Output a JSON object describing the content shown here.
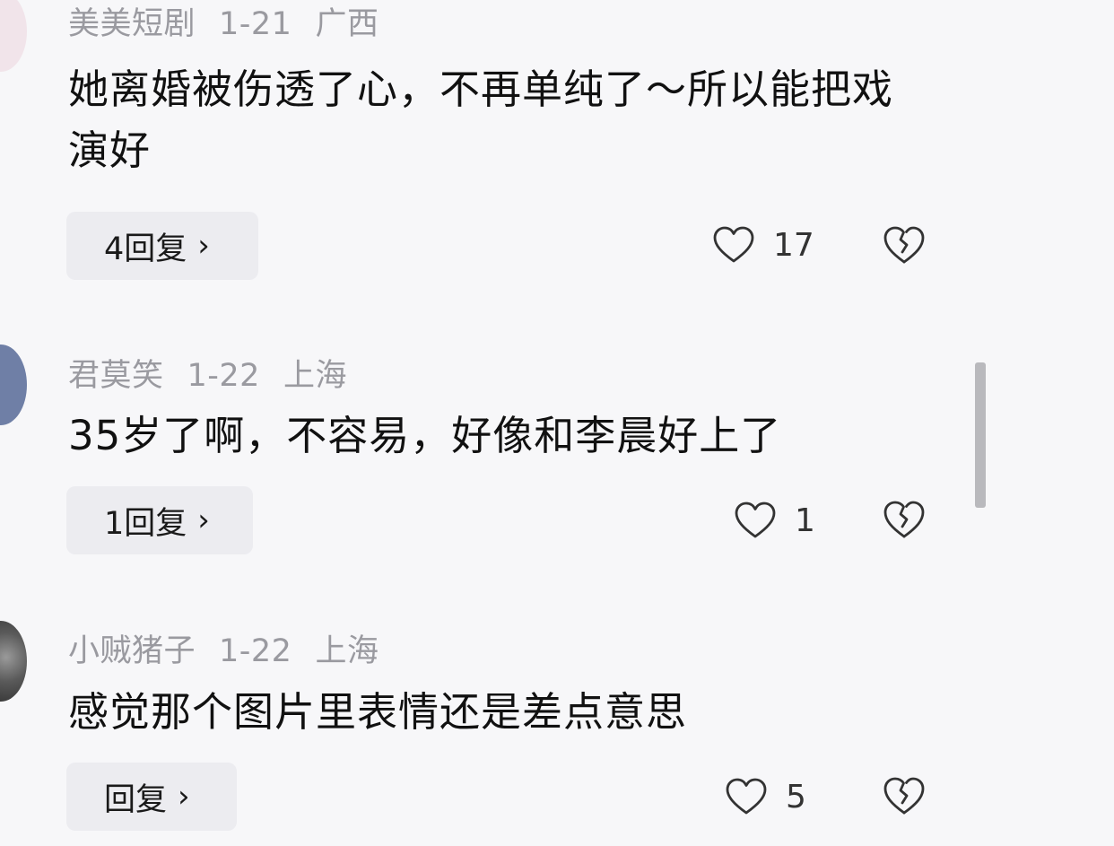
{
  "comments": [
    {
      "username": "美美短剧",
      "date": "1-21",
      "location": "广西",
      "text": "她离婚被伤透了心，不再单纯了～所以能把戏演好",
      "reply_label": "4回复",
      "likes": "17"
    },
    {
      "username": "君莫笑",
      "date": "1-22",
      "location": "上海",
      "text": "35岁了啊，不容易，好像和李晨好上了",
      "reply_label": "1回复",
      "likes": "1"
    },
    {
      "username": "小贼猪子",
      "date": "1-22",
      "location": "上海",
      "text": "感觉那个图片里表情还是差点意思",
      "reply_label": "回复",
      "likes": "5"
    }
  ],
  "icons": {
    "like": "heart-outline-icon",
    "dislike": "broken-heart-icon",
    "reply_chevron": "chevron-right-icon"
  },
  "reply_chevron_glyph": "›",
  "colors": {
    "background": "#f7f7f9",
    "meta_text": "#9a9aa0",
    "comment_text": "#111111",
    "reply_button_bg": "#ececf0"
  }
}
